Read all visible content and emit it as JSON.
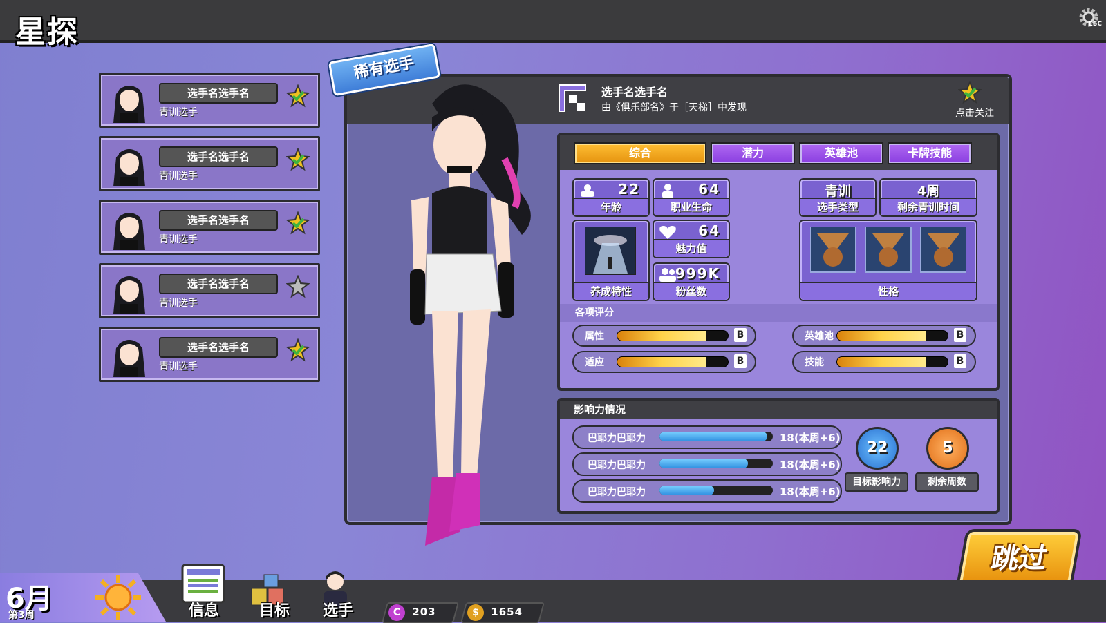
{
  "header": {
    "title": "星探",
    "esc_label": "ESC"
  },
  "scouts": [
    {
      "name": "选手名选手名",
      "type": "青训选手",
      "followed": true
    },
    {
      "name": "选手名选手名",
      "type": "青训选手",
      "followed": true
    },
    {
      "name": "选手名选手名",
      "type": "青训选手",
      "followed": true
    },
    {
      "name": "选手名选手名",
      "type": "青训选手",
      "followed": false
    },
    {
      "name": "选手名选手名",
      "type": "青训选手",
      "followed": true
    }
  ],
  "player": {
    "rarity_badge": "稀有选手",
    "name": "选手名选手名",
    "origin": "由《俱乐部名》于［天梯］中发现",
    "follow_label": "点击关注"
  },
  "tabs": [
    "综合",
    "潜力",
    "英雄池",
    "卡牌技能"
  ],
  "active_tab": 0,
  "stats": {
    "age": {
      "value": "22",
      "label": "年龄"
    },
    "career": {
      "value": "64",
      "label": "职业生命"
    },
    "charm": {
      "value": "64",
      "label": "魅力值"
    },
    "fans": {
      "value": "999K",
      "label": "粉丝数"
    },
    "trait_label": "养成特性",
    "player_type": {
      "value": "青训",
      "label": "选手类型"
    },
    "training_time": {
      "value": "4周",
      "label": "剩余青训时间"
    },
    "personality_label": "性格"
  },
  "ratings_title": "各项评分",
  "ratings": [
    {
      "label": "属性",
      "fill": 0.8,
      "grade": "B"
    },
    {
      "label": "英雄池",
      "fill": 0.8,
      "grade": "B"
    },
    {
      "label": "适应",
      "fill": 0.8,
      "grade": "B"
    },
    {
      "label": "技能",
      "fill": 0.8,
      "grade": "B"
    }
  ],
  "influence": {
    "title": "影响力情况",
    "rows": [
      {
        "name": "巴耶力巴耶力",
        "fill": 0.95,
        "value": "18(本周+6)"
      },
      {
        "name": "巴耶力巴耶力",
        "fill": 0.78,
        "value": "18(本周+6)"
      },
      {
        "name": "巴耶力巴耶力",
        "fill": 0.48,
        "value": "18(本周+6)"
      }
    ],
    "target": {
      "value": "22",
      "label": "目标影响力"
    },
    "remaining": {
      "value": "5",
      "label": "剩余周数"
    }
  },
  "skip_label": "跳过",
  "calendar": {
    "month": "6月",
    "week": "第3周"
  },
  "nav": [
    {
      "label": "信息"
    },
    {
      "label": "目标"
    },
    {
      "label": "选手"
    }
  ],
  "currency": [
    {
      "symbol": "C",
      "value": "203",
      "color": "#c040d0"
    },
    {
      "symbol": "$",
      "value": "1654",
      "color": "#e0a020"
    }
  ]
}
